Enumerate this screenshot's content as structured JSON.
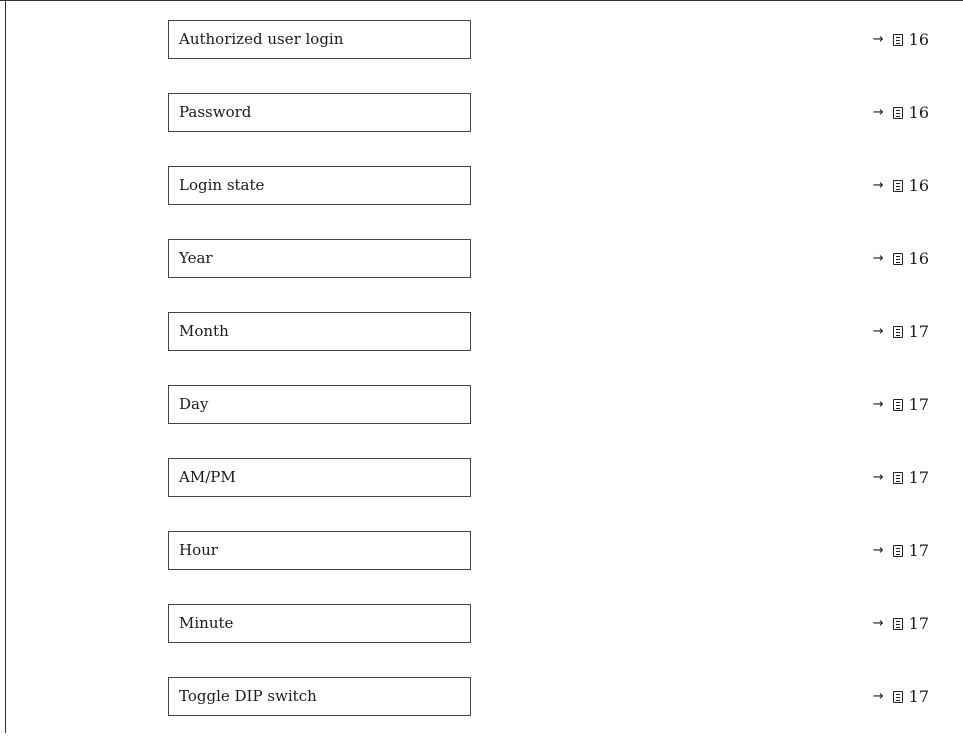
{
  "parameters": [
    {
      "label": "Authorized user login",
      "arrow": "→",
      "page": "16"
    },
    {
      "label": "Password",
      "arrow": "→",
      "page": "16"
    },
    {
      "label": "Login state",
      "arrow": "→",
      "page": "16"
    },
    {
      "label": "Year",
      "arrow": "→",
      "page": "16"
    },
    {
      "label": "Month",
      "arrow": "→",
      "page": "17"
    },
    {
      "label": "Day",
      "arrow": "→",
      "page": "17"
    },
    {
      "label": "AM/PM",
      "arrow": "→",
      "page": "17"
    },
    {
      "label": "Hour",
      "arrow": "→",
      "page": "17"
    },
    {
      "label": "Minute",
      "arrow": "→",
      "page": "17"
    },
    {
      "label": "Toggle DIP switch",
      "arrow": "→",
      "page": "17"
    }
  ],
  "icons": {
    "arrow": "right-arrow-icon",
    "page": "document-page-icon"
  }
}
